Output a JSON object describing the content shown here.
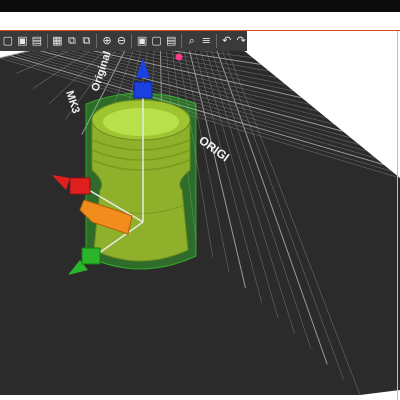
{
  "window": {
    "tab_accent_color": "#d24a1e",
    "topbar_color": "#0c0c0c"
  },
  "toolbar": {
    "tools": [
      {
        "name": "add-icon"
      },
      {
        "name": "delete-icon"
      },
      {
        "name": "delete-all-icon"
      },
      {
        "name": "arrange-icon"
      },
      {
        "name": "copy-icon"
      },
      {
        "name": "paste-icon"
      },
      {
        "name": "zoom-in-icon"
      },
      {
        "name": "zoom-out-icon"
      },
      {
        "name": "split-objects-icon"
      },
      {
        "name": "split-parts-icon"
      },
      {
        "name": "variable-layer-height-icon"
      },
      {
        "name": "search-icon"
      },
      {
        "name": "layers-editing-icon"
      },
      {
        "name": "undo-icon"
      },
      {
        "name": "redo-icon"
      }
    ]
  },
  "bed": {
    "label_line1": "Original Prusa",
    "label_line2": "MK3",
    "label_origin": "ORIGI",
    "colors": {
      "bed": "#2b2b2b",
      "grid": "#6a6a6a",
      "grid_major": "#9a9a9a"
    }
  },
  "model": {
    "body_color": "#8fb02a",
    "highlight_color": "#b8e04a",
    "bounding_color": "#37e22b"
  },
  "gizmo": {
    "x_color": "#e0201f",
    "y_color": "#2bb52b",
    "z_color": "#1c3fe0",
    "handle_color": "#f28c1c"
  }
}
